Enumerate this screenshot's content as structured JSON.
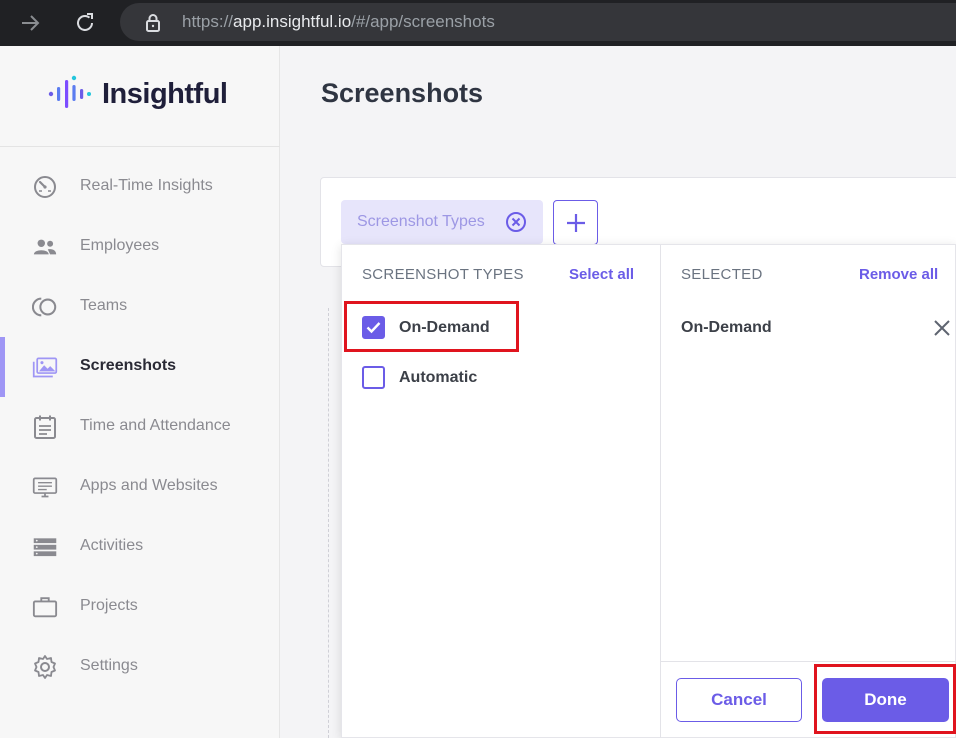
{
  "browser": {
    "url_scheme": "https://",
    "url_host": "app.insightful.io",
    "url_path": "/#/app/screenshots"
  },
  "logo": {
    "text": "Insightful"
  },
  "sidebar": {
    "items": [
      {
        "label": "Real-Time Insights",
        "icon": "gauge-icon"
      },
      {
        "label": "Employees",
        "icon": "users-icon"
      },
      {
        "label": "Teams",
        "icon": "teams-icon"
      },
      {
        "label": "Screenshots",
        "icon": "images-icon",
        "active": true
      },
      {
        "label": "Time and Attendance",
        "icon": "calendar-icon"
      },
      {
        "label": "Apps and Websites",
        "icon": "monitor-icon"
      },
      {
        "label": "Activities",
        "icon": "server-icon"
      },
      {
        "label": "Projects",
        "icon": "briefcase-icon"
      },
      {
        "label": "Settings",
        "icon": "gear-icon"
      }
    ]
  },
  "main": {
    "title": "Screenshots",
    "filter_chip": {
      "label": "Screenshot Types"
    }
  },
  "dropdown": {
    "left_header": "SCREENSHOT TYPES",
    "select_all": "Select all",
    "right_header": "SELECTED",
    "remove_all": "Remove all",
    "options": [
      {
        "label": "On-Demand",
        "checked": true
      },
      {
        "label": "Automatic",
        "checked": false
      }
    ],
    "selected": [
      {
        "label": "On-Demand"
      }
    ],
    "cancel_label": "Cancel",
    "done_label": "Done"
  },
  "colors": {
    "accent": "#6b5ce7",
    "highlight": "#e0141e",
    "browser_bar": "#202124"
  }
}
